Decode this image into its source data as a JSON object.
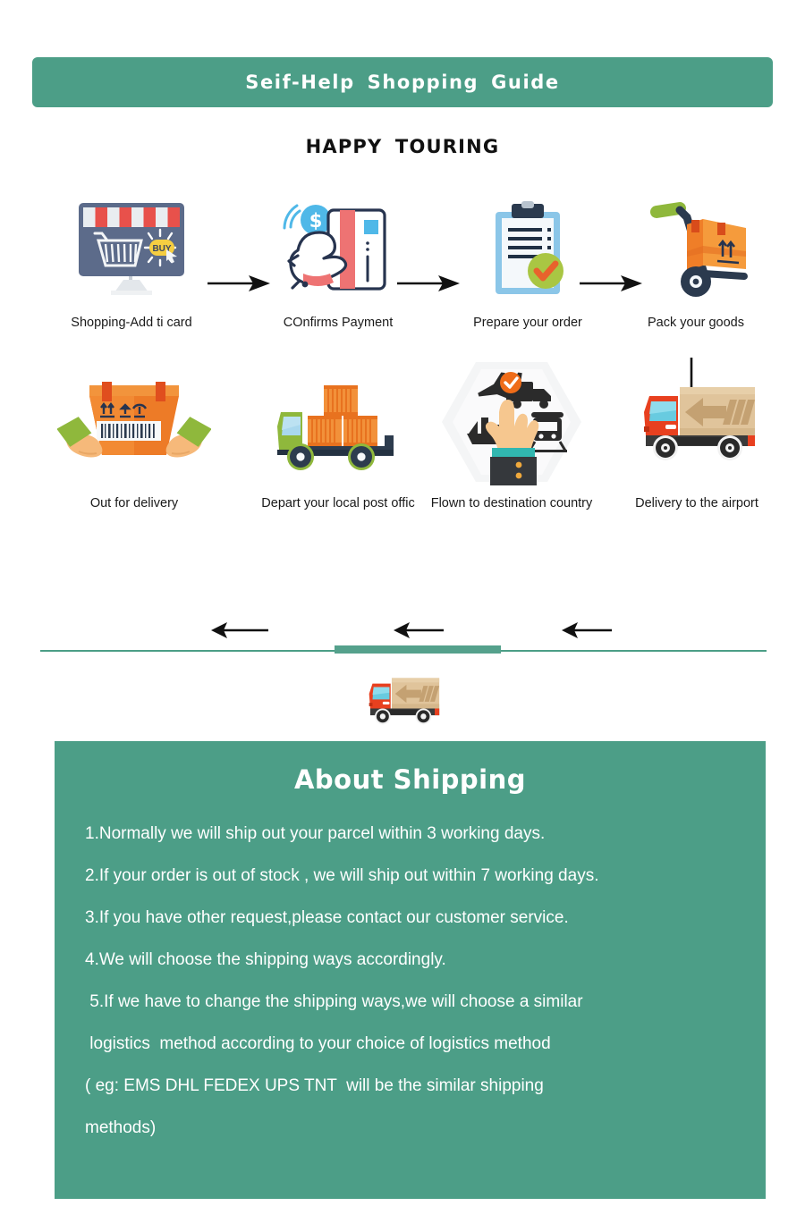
{
  "header": {
    "title": "Seif-Help  Shopping  Guide",
    "accent_color": "#4C9E87"
  },
  "subtitle": "HAPPY  TOURING",
  "flow": {
    "row1": [
      {
        "icon": "online-shop-monitor-icon",
        "label": "Shopping-Add ti card",
        "buy_button_text": "BUY"
      },
      {
        "icon": "hand-credit-card-payment-icon",
        "label": "COnfirms Payment"
      },
      {
        "icon": "clipboard-checkmark-icon",
        "label": "Prepare your order"
      },
      {
        "icon": "hand-truck-box-icon",
        "label": "Pack your goods"
      }
    ],
    "row2": [
      {
        "icon": "delivery-truck-arrow-icon",
        "label": "Delivery to the airport"
      },
      {
        "icon": "hand-transport-modes-hexagon-icon",
        "label": "Flown to destination country"
      },
      {
        "icon": "container-flatbed-truck-icon",
        "label": "Depart your local post offic"
      },
      {
        "icon": "hands-holding-parcel-icon",
        "label": "Out for delivery"
      }
    ],
    "arrows": [
      "arrow-right-icon",
      "arrow-right-icon",
      "arrow-right-icon",
      "arrow-down-icon",
      "arrow-left-icon",
      "arrow-left-icon",
      "arrow-left-icon"
    ]
  },
  "divider": {
    "icon": "mini-delivery-truck-icon",
    "color": "#4C9E87"
  },
  "about": {
    "title": "About Shipping",
    "background_color": "#4C9E87",
    "lines": [
      "1.Normally we will ship out your parcel within 3 working days.",
      "2.If your order is out of stock , we will ship out within 7 working days.",
      "3.If you have other request,please contact our customer service.",
      "4.We will choose the shipping ways accordingly.",
      " 5.If we have to change the shipping ways,we will choose a similar",
      " logistics  method according to your choice of logistics method",
      "( eg: EMS DHL FEDEX UPS TNT  will be the similar shipping",
      "methods)"
    ]
  }
}
